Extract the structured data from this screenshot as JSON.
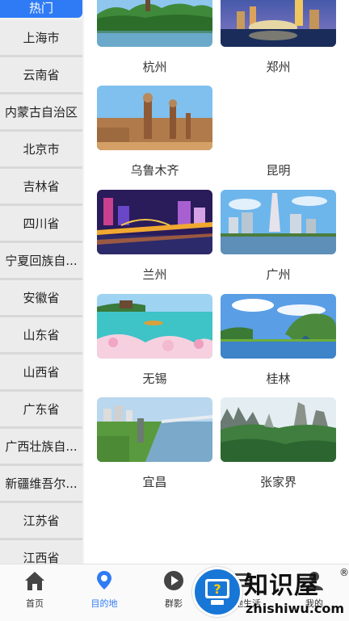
{
  "sidebar": {
    "items": [
      {
        "label": "热门",
        "active": true
      },
      {
        "label": "上海市"
      },
      {
        "label": "云南省"
      },
      {
        "label": "内蒙古自治区"
      },
      {
        "label": "北京市"
      },
      {
        "label": "吉林省"
      },
      {
        "label": "四川省"
      },
      {
        "label": "宁夏回族自..."
      },
      {
        "label": "安徽省"
      },
      {
        "label": "山东省"
      },
      {
        "label": "山西省"
      },
      {
        "label": "广东省"
      },
      {
        "label": "广西壮族自..."
      },
      {
        "label": "新疆维吾尔..."
      },
      {
        "label": "江苏省"
      },
      {
        "label": "江西省"
      }
    ]
  },
  "cities": [
    {
      "name": "杭州",
      "image": "hangzhou-lake-photo"
    },
    {
      "name": "郑州",
      "image": "zhengzhou-night-photo"
    },
    {
      "name": "乌鲁木齐",
      "image": "urumqi-bazaar-photo"
    },
    {
      "name": "昆明",
      "image": ""
    },
    {
      "name": "兰州",
      "image": "lanzhou-bridge-night-photo"
    },
    {
      "name": "广州",
      "image": "guangzhou-tower-photo"
    },
    {
      "name": "无锡",
      "image": "wuxi-lake-blossom-photo"
    },
    {
      "name": "桂林",
      "image": "guilin-elephant-hill-photo"
    },
    {
      "name": "宜昌",
      "image": "yichang-river-photo"
    },
    {
      "name": "张家界",
      "image": "zhangjiajie-peaks-photo"
    }
  ],
  "bottom_nav": [
    {
      "label": "首页",
      "icon": "home-icon"
    },
    {
      "label": "目的地",
      "icon": "location-pin-icon",
      "active": true
    },
    {
      "label": "群影",
      "icon": "play-icon"
    },
    {
      "label": "本地生活",
      "icon": "menu-icon"
    },
    {
      "label": "我的",
      "icon": "user-icon"
    }
  ],
  "watermark": {
    "title": "知识屋",
    "subtitle": "zhishiwu.com",
    "reg": "®"
  },
  "colors": {
    "accent": "#2f7bf5",
    "sidebar_bg": "#ececec"
  }
}
